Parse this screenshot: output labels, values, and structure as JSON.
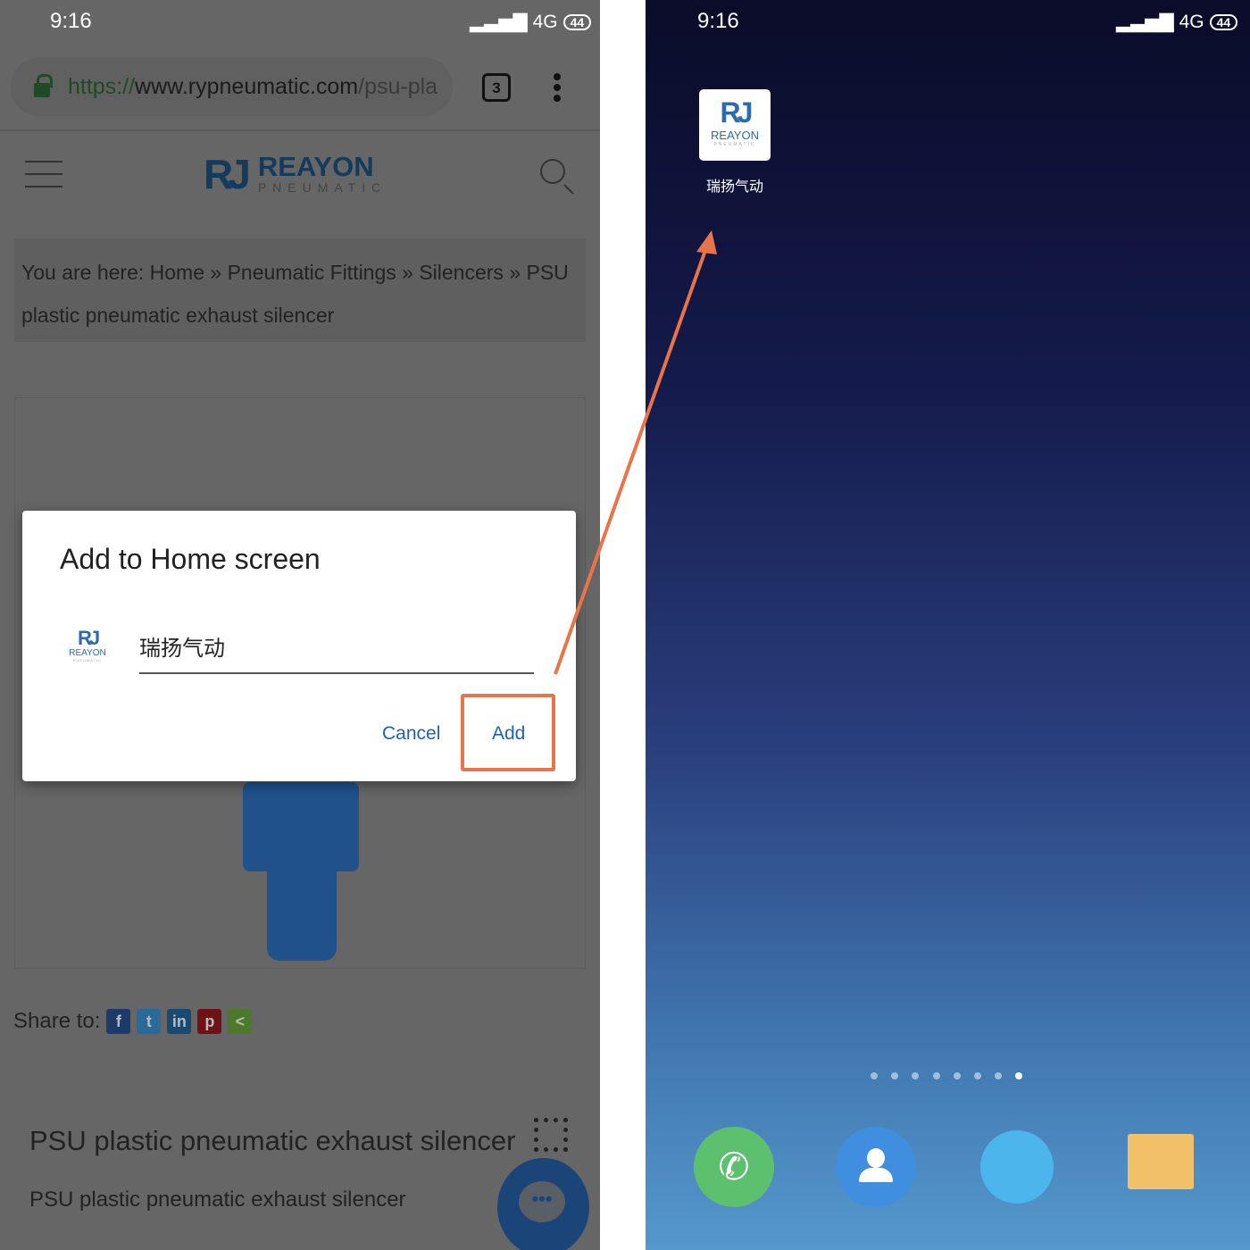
{
  "left": {
    "status": {
      "time": "9:16",
      "network": "4G",
      "battery": "44"
    },
    "browser": {
      "url_scheme": "https://",
      "url_host": "www.rypneumatic.com",
      "url_path": "/psu-pla",
      "tab_count": "3"
    },
    "site": {
      "logo_main": "REAYON",
      "logo_sub": "PNEUMATIC",
      "logo_mark": "RJ"
    },
    "breadcrumb": "You are here: Home » Pneumatic Fittings » Silencers » PSU plastic pneumatic exhaust silencer",
    "share_label": "Share to:",
    "share_icons": [
      "f",
      "t",
      "in",
      "p",
      "<"
    ],
    "product_title": "PSU plastic pneumatic exhaust silencer",
    "product_subtitle": "PSU plastic pneumatic exhaust silencer",
    "dialog": {
      "title": "Add to Home screen",
      "name_value": "瑞扬气动",
      "cancel": "Cancel",
      "add": "Add",
      "logo_text": "REAYON",
      "logo_sub": "PNEUMATIC"
    }
  },
  "right": {
    "status": {
      "time": "9:16",
      "network": "4G",
      "battery": "44"
    },
    "app_icon": {
      "label": "瑞扬气动",
      "logo_text": "REAYON",
      "logo_sub": "PNEUMATIC",
      "logo_mark": "RJ"
    },
    "page_count": 8,
    "active_page": 8,
    "dock": [
      "phone",
      "contacts",
      "browser",
      "messages"
    ]
  },
  "colors": {
    "highlight": "#e8744a",
    "link": "#1a62c4",
    "brand": "#2b6cb0"
  }
}
